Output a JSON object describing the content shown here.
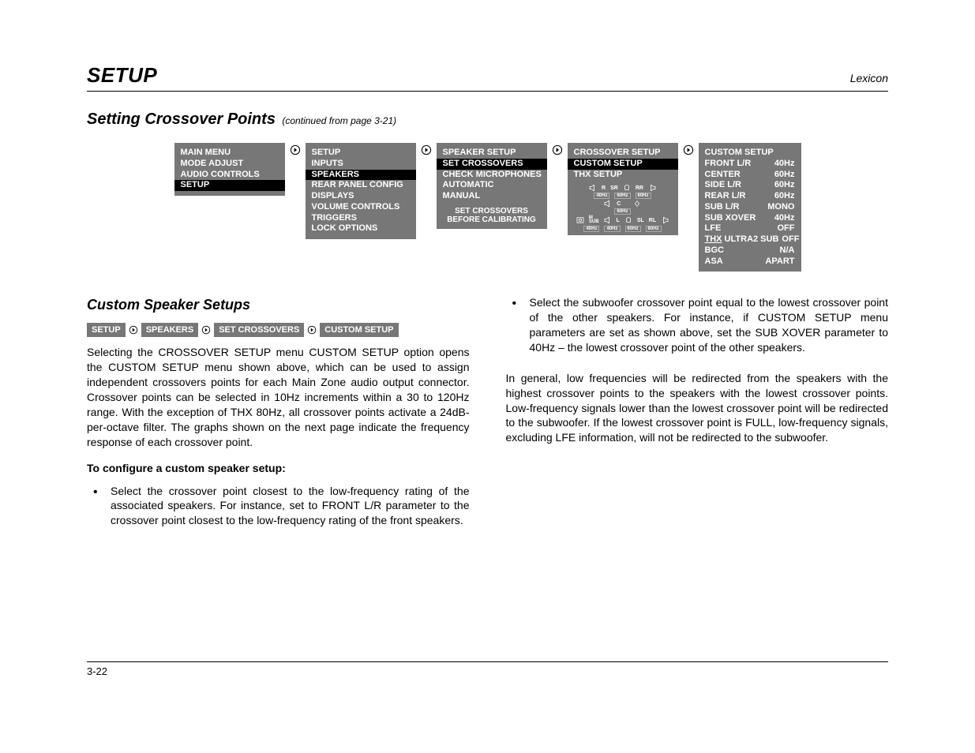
{
  "header": {
    "title": "SETUP",
    "brand": "Lexicon"
  },
  "section": {
    "title": "Setting Crossover Points",
    "cont": "(continued from page 3-21)"
  },
  "menus": {
    "m1": {
      "items": [
        "MAIN MENU",
        "MODE ADJUST",
        "AUDIO CONTROLS",
        "SETUP"
      ],
      "highlight": 3
    },
    "m2": {
      "items": [
        "SETUP",
        "INPUTS",
        "SPEAKERS",
        "REAR PANEL CONFIG",
        "DISPLAYS",
        "VOLUME CONTROLS",
        "TRIGGERS",
        "LOCK OPTIONS"
      ],
      "highlight": 2
    },
    "m3": {
      "items": [
        "SPEAKER SETUP",
        "SET CROSSOVERS",
        "CHECK MICROPHONES",
        "AUTOMATIC",
        "MANUAL"
      ],
      "highlight": 1,
      "note1": "SET CROSSOVERS",
      "note2": "BEFORE CALIBRATING"
    },
    "m4": {
      "items": [
        "CROSSOVER SETUP",
        "CUSTOM SETUP",
        "THX SETUP"
      ],
      "highlight": 1,
      "diagram": {
        "row1": {
          "r": "R",
          "sr": "SR",
          "rr": "RR"
        },
        "row1f": [
          "40Hz",
          "60Hz",
          "60Hz"
        ],
        "row2": {
          "c": "C"
        },
        "row2f": [
          "60Hz"
        ],
        "row3": {
          "msub": "M\nSUB",
          "l": "L",
          "sl": "SL",
          "rl": "RL"
        },
        "row3f": [
          "40Hz",
          "40Hz",
          "60Hz",
          "60Hz"
        ]
      }
    },
    "m5": {
      "title": "CUSTOM SETUP",
      "rows": [
        {
          "k": "FRONT L/R",
          "v": "40Hz"
        },
        {
          "k": "CENTER",
          "v": "60Hz"
        },
        {
          "k": "SIDE L/R",
          "v": "60Hz"
        },
        {
          "k": "REAR L/R",
          "v": "60Hz"
        },
        {
          "k": "SUB L/R",
          "v": "MONO"
        },
        {
          "k": "SUB XOVER",
          "v": "40Hz"
        },
        {
          "k": "LFE",
          "v": "OFF"
        },
        {
          "k": "THX ULTRA2 SUB",
          "v": "OFF",
          "thx": true
        },
        {
          "k": "BGC",
          "v": "N/A"
        },
        {
          "k": "ASA",
          "v": "APART"
        }
      ]
    }
  },
  "crumbs": [
    "SETUP",
    "SPEAKERS",
    "SET CROSSOVERS",
    "CUSTOM SETUP"
  ],
  "sub_head": "Custom Speaker Setups",
  "p1": "Selecting the CROSSOVER SETUP menu CUSTOM SETUP option opens the CUSTOM SETUP menu shown above, which can be used to assign independent crossovers points for each Main Zone audio output connector. Crossover points can be selected in 10Hz increments within a 30 to 120Hz range. With the exception of THX 80Hz, all crossover points activate a 24dB-per-octave filter. The graphs shown on the next page indicate the frequency response of each crossover point.",
  "bold_line": "To configure a custom speaker setup:",
  "b1": "Select the crossover point closest to the low-frequency rating of the associated speakers. For instance, set to FRONT L/R parameter to the crossover point closest to the low-frequency rating of the front speakers.",
  "b2": "Select the subwoofer crossover point equal to the lowest crossover point of the other speakers. For instance, if CUSTOM SETUP menu parameters are set as shown above, set the SUB XOVER parameter to 40Hz –  the lowest crossover point of the other speakers.",
  "p2": "In general, low frequencies will be redirected from the speakers with the highest crossover points to the speakers with the lowest crossover points. Low-frequency signals lower than the lowest crossover point will be redirected to the subwoofer. If the lowest crossover point is FULL, low-frequency signals, excluding LFE information, will not be redirected to the subwoofer.",
  "page_num": "3-22"
}
